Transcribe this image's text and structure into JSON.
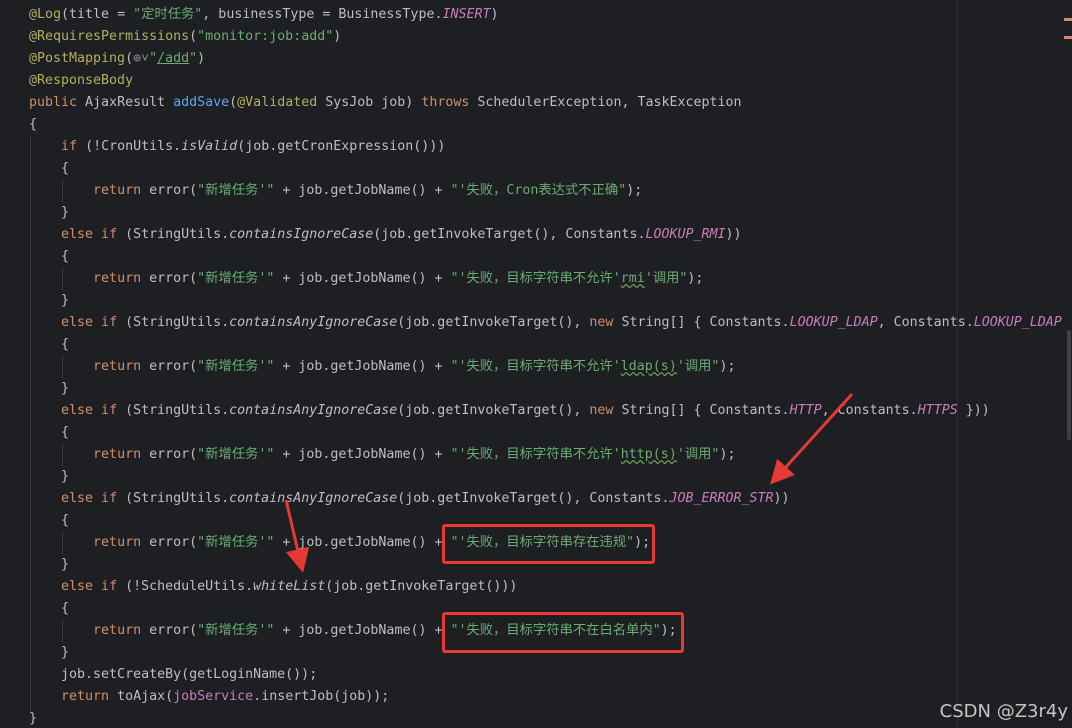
{
  "editor": {
    "watermark": "CSDN @Z3r4y",
    "accent_colors": {
      "keyword": "#cf8e6d",
      "string": "#6aab73",
      "annotation": "#b3ae60",
      "method": "#56a8f5",
      "static_field": "#c77dbb",
      "plain": "#bcbec4",
      "highlight_box": "#e53935"
    }
  },
  "code": {
    "lines": [
      [
        {
          "t": "@Log",
          "c": "t-ann"
        },
        {
          "t": "(title = ",
          "c": "t-pl"
        },
        {
          "t": "\"定时任务\"",
          "c": "t-str"
        },
        {
          "t": ", businessType = BusinessType.",
          "c": "t-pl"
        },
        {
          "t": "INSERT",
          "c": "t-static"
        },
        {
          "t": ")",
          "c": "t-pl"
        }
      ],
      [
        {
          "t": "@RequiresPermissions",
          "c": "t-ann"
        },
        {
          "t": "(",
          "c": "t-pl"
        },
        {
          "t": "\"monitor:job:add\"",
          "c": "t-str"
        },
        {
          "t": ")",
          "c": "t-pl"
        }
      ],
      [
        {
          "t": "@PostMapping",
          "c": "t-ann"
        },
        {
          "t": "(",
          "c": "t-pl"
        },
        {
          "t": "⊕",
          "c": "globe"
        },
        {
          "t": "˅",
          "c": "globe"
        },
        {
          "t": "\"",
          "c": "t-str"
        },
        {
          "t": "/add",
          "c": "t-str t-u"
        },
        {
          "t": "\"",
          "c": "t-str"
        },
        {
          "t": ")",
          "c": "t-pl"
        }
      ],
      [
        {
          "t": "@ResponseBody",
          "c": "t-ann"
        }
      ],
      [
        {
          "t": "public ",
          "c": "t-kw"
        },
        {
          "t": "AjaxResult ",
          "c": "t-cls"
        },
        {
          "t": "addSave",
          "c": "t-fn"
        },
        {
          "t": "(",
          "c": "t-pl"
        },
        {
          "t": "@Validated",
          "c": "t-ann"
        },
        {
          "t": " SysJob job) ",
          "c": "t-pl"
        },
        {
          "t": "throws ",
          "c": "t-kw"
        },
        {
          "t": "SchedulerException, TaskException",
          "c": "t-pl"
        }
      ],
      [
        {
          "t": "{",
          "c": "t-pl"
        }
      ],
      [
        {
          "t": "    ",
          "c": "t-pl"
        },
        {
          "t": "if ",
          "c": "t-kw"
        },
        {
          "t": "(!CronUtils.",
          "c": "t-pl"
        },
        {
          "t": "isValid",
          "c": "t-pl t-fn-it"
        },
        {
          "t": "(job.getCronExpression()))",
          "c": "t-pl"
        }
      ],
      [
        {
          "t": "    {",
          "c": "t-pl"
        }
      ],
      [
        {
          "t": "        ",
          "c": "t-pl"
        },
        {
          "t": "return ",
          "c": "t-kw"
        },
        {
          "t": "error(",
          "c": "t-pl"
        },
        {
          "t": "\"新增任务'\"",
          "c": "t-str"
        },
        {
          "t": " + job.getJobName() + ",
          "c": "t-pl"
        },
        {
          "t": "\"'失败，Cron表达式不正确\"",
          "c": "t-str"
        },
        {
          "t": ");",
          "c": "t-pl"
        }
      ],
      [
        {
          "t": "    }",
          "c": "t-pl"
        }
      ],
      [
        {
          "t": "    ",
          "c": "t-pl"
        },
        {
          "t": "else if ",
          "c": "t-kw"
        },
        {
          "t": "(StringUtils.",
          "c": "t-pl"
        },
        {
          "t": "containsIgnoreCase",
          "c": "t-pl t-fn-it"
        },
        {
          "t": "(job.getInvokeTarget(), Constants.",
          "c": "t-pl"
        },
        {
          "t": "LOOKUP_RMI",
          "c": "t-static"
        },
        {
          "t": "))",
          "c": "t-pl"
        }
      ],
      [
        {
          "t": "    {",
          "c": "t-pl"
        }
      ],
      [
        {
          "t": "        ",
          "c": "t-pl"
        },
        {
          "t": "return ",
          "c": "t-kw"
        },
        {
          "t": "error(",
          "c": "t-pl"
        },
        {
          "t": "\"新增任务'\"",
          "c": "t-str"
        },
        {
          "t": " + job.getJobName() + ",
          "c": "t-pl"
        },
        {
          "t": "\"'失败，目标字符串不允许'",
          "c": "t-str"
        },
        {
          "t": "rmi",
          "c": "t-str t-wave"
        },
        {
          "t": "'调用\"",
          "c": "t-str"
        },
        {
          "t": ");",
          "c": "t-pl"
        }
      ],
      [
        {
          "t": "    }",
          "c": "t-pl"
        }
      ],
      [
        {
          "t": "    ",
          "c": "t-pl"
        },
        {
          "t": "else if ",
          "c": "t-kw"
        },
        {
          "t": "(StringUtils.",
          "c": "t-pl"
        },
        {
          "t": "containsAnyIgnoreCase",
          "c": "t-pl t-fn-it"
        },
        {
          "t": "(job.getInvokeTarget(), ",
          "c": "t-pl"
        },
        {
          "t": "new ",
          "c": "t-kw"
        },
        {
          "t": "String[] { Constants.",
          "c": "t-pl"
        },
        {
          "t": "LOOKUP_LDAP",
          "c": "t-static"
        },
        {
          "t": ", Constants.",
          "c": "t-pl"
        },
        {
          "t": "LOOKUP_LDAPS",
          "c": "t-static"
        }
      ],
      [
        {
          "t": "    {",
          "c": "t-pl"
        }
      ],
      [
        {
          "t": "        ",
          "c": "t-pl"
        },
        {
          "t": "return ",
          "c": "t-kw"
        },
        {
          "t": "error(",
          "c": "t-pl"
        },
        {
          "t": "\"新增任务'\"",
          "c": "t-str"
        },
        {
          "t": " + job.getJobName() + ",
          "c": "t-pl"
        },
        {
          "t": "\"'失败，目标字符串不允许'",
          "c": "t-str"
        },
        {
          "t": "ldap(s)",
          "c": "t-str t-wave"
        },
        {
          "t": "'调用\"",
          "c": "t-str"
        },
        {
          "t": ");",
          "c": "t-pl"
        }
      ],
      [
        {
          "t": "    }",
          "c": "t-pl"
        }
      ],
      [
        {
          "t": "    ",
          "c": "t-pl"
        },
        {
          "t": "else if ",
          "c": "t-kw"
        },
        {
          "t": "(StringUtils.",
          "c": "t-pl"
        },
        {
          "t": "containsAnyIgnoreCase",
          "c": "t-pl t-fn-it"
        },
        {
          "t": "(job.getInvokeTarget(), ",
          "c": "t-pl"
        },
        {
          "t": "new ",
          "c": "t-kw"
        },
        {
          "t": "String[] { Constants.",
          "c": "t-pl"
        },
        {
          "t": "HTTP",
          "c": "t-static"
        },
        {
          "t": ", Constants.",
          "c": "t-pl"
        },
        {
          "t": "HTTPS",
          "c": "t-static"
        },
        {
          "t": " }))",
          "c": "t-pl"
        }
      ],
      [
        {
          "t": "    {",
          "c": "t-pl"
        }
      ],
      [
        {
          "t": "        ",
          "c": "t-pl"
        },
        {
          "t": "return ",
          "c": "t-kw"
        },
        {
          "t": "error(",
          "c": "t-pl"
        },
        {
          "t": "\"新增任务'\"",
          "c": "t-str"
        },
        {
          "t": " + job.getJobName() + ",
          "c": "t-pl"
        },
        {
          "t": "\"'失败，目标字符串不允许'",
          "c": "t-str"
        },
        {
          "t": "http(s)",
          "c": "t-str t-wave"
        },
        {
          "t": "'调用\"",
          "c": "t-str"
        },
        {
          "t": ");",
          "c": "t-pl"
        }
      ],
      [
        {
          "t": "    }",
          "c": "t-pl"
        }
      ],
      [
        {
          "t": "    ",
          "c": "t-pl"
        },
        {
          "t": "else if ",
          "c": "t-kw"
        },
        {
          "t": "(StringUtils.",
          "c": "t-pl"
        },
        {
          "t": "containsAnyIgnoreCase",
          "c": "t-pl t-fn-it"
        },
        {
          "t": "(job.getInvokeTarget(), Constants.",
          "c": "t-pl"
        },
        {
          "t": "JOB_ERROR_STR",
          "c": "t-static"
        },
        {
          "t": "))",
          "c": "t-pl"
        }
      ],
      [
        {
          "t": "    {",
          "c": "t-pl"
        }
      ],
      [
        {
          "t": "        ",
          "c": "t-pl"
        },
        {
          "t": "return ",
          "c": "t-kw"
        },
        {
          "t": "error(",
          "c": "t-pl"
        },
        {
          "t": "\"新增任务'\"",
          "c": "t-str"
        },
        {
          "t": " + job.getJobName() + ",
          "c": "t-pl"
        },
        {
          "t": "\"'失败，目标字符串存在违规\"",
          "c": "t-str"
        },
        {
          "t": ");",
          "c": "t-pl"
        }
      ],
      [
        {
          "t": "    }",
          "c": "t-pl"
        }
      ],
      [
        {
          "t": "    ",
          "c": "t-pl"
        },
        {
          "t": "else if ",
          "c": "t-kw"
        },
        {
          "t": "(!ScheduleUtils.",
          "c": "t-pl"
        },
        {
          "t": "whiteList",
          "c": "t-pl t-fn-it"
        },
        {
          "t": "(job.getInvokeTarget()))",
          "c": "t-pl"
        }
      ],
      [
        {
          "t": "    {",
          "c": "t-pl"
        }
      ],
      [
        {
          "t": "        ",
          "c": "t-pl"
        },
        {
          "t": "return ",
          "c": "t-kw"
        },
        {
          "t": "error(",
          "c": "t-pl"
        },
        {
          "t": "\"新增任务'\"",
          "c": "t-str"
        },
        {
          "t": " + job.getJobName() + ",
          "c": "t-pl"
        },
        {
          "t": "\"'失败，目标字符串不在白名单内\"",
          "c": "t-str"
        },
        {
          "t": ");",
          "c": "t-pl"
        }
      ],
      [
        {
          "t": "    }",
          "c": "t-pl"
        }
      ],
      [
        {
          "t": "    job.setCreateBy(getLoginName());",
          "c": "t-pl"
        }
      ],
      [
        {
          "t": "    ",
          "c": "t-pl"
        },
        {
          "t": "return ",
          "c": "t-kw"
        },
        {
          "t": "toAjax(",
          "c": "t-pl"
        },
        {
          "t": "jobService",
          "c": "t-field"
        },
        {
          "t": ".insertJob(job));",
          "c": "t-pl"
        }
      ],
      [
        {
          "t": "}",
          "c": "t-pl"
        }
      ]
    ]
  }
}
